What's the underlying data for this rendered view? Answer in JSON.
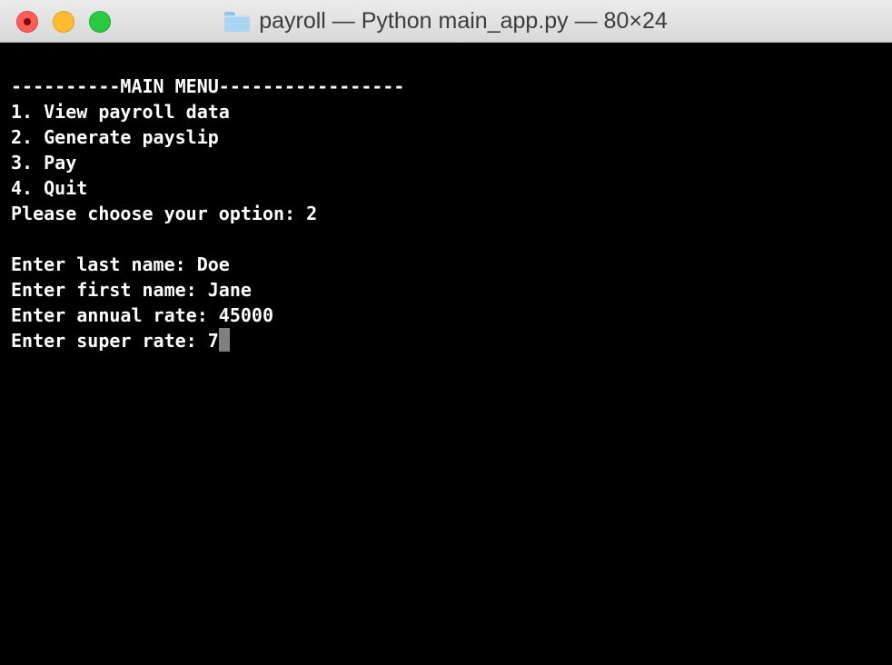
{
  "window": {
    "title": "payroll — Python main_app.py — 80×24"
  },
  "terminal": {
    "lines": [
      "----------MAIN MENU-----------------",
      "1. View payroll data",
      "2. Generate payslip",
      "3. Pay",
      "4. Quit",
      "Please choose your option: 2",
      "",
      "Enter last name: Doe",
      "Enter first name: Jane",
      "Enter annual rate: 45000",
      "Enter super rate: 7"
    ]
  },
  "colors": {
    "background": "#000000",
    "text": "#ffffff",
    "cursor": "#808080",
    "close": "#fd5e57",
    "minimize": "#febc2e",
    "maximize": "#29c940"
  },
  "icons": {
    "title_icon": "folder-icon"
  }
}
